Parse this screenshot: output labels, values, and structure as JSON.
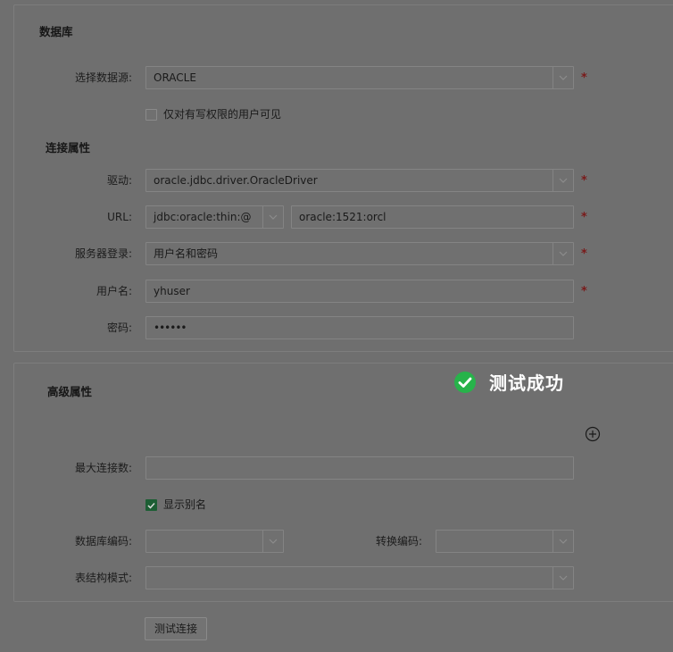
{
  "database": {
    "title": "数据库",
    "datasource": {
      "label": "选择数据源:",
      "value": "ORACLE",
      "required": "*"
    },
    "writable_only": {
      "label": "仅对有写权限的用户可见",
      "checked": false
    }
  },
  "connection": {
    "title": "连接属性",
    "driver": {
      "label": "驱动:",
      "value": "oracle.jdbc.driver.OracleDriver",
      "required": "*"
    },
    "url": {
      "label": "URL:",
      "prefix": "jdbc:oracle:thin:@",
      "value": "oracle:1521:orcl",
      "required": "*"
    },
    "server_login": {
      "label": "服务器登录:",
      "value": "用户名和密码",
      "required": "*"
    },
    "username": {
      "label": "用户名:",
      "value": "yhuser",
      "required": "*"
    },
    "password": {
      "label": "密码:",
      "value": "••••••"
    }
  },
  "advanced": {
    "title": "高级属性",
    "max_connections": {
      "label": "最大连接数:",
      "value": ""
    },
    "show_alias": {
      "label": "显示别名",
      "checked": true
    },
    "db_encoding": {
      "label": "数据库编码:",
      "value": ""
    },
    "convert_encoding": {
      "label": "转换编码:",
      "value": ""
    },
    "table_schema": {
      "label": "表结构模式:",
      "value": ""
    }
  },
  "test_button": {
    "label": "测试连接"
  },
  "toast": {
    "message": "测试成功",
    "icon": "check-circle-icon",
    "color": "#27b34a"
  },
  "colors": {
    "required": "#7a1a1a",
    "checkbox_checked": "#1d5e34",
    "overlay": "#6f6f6f"
  }
}
